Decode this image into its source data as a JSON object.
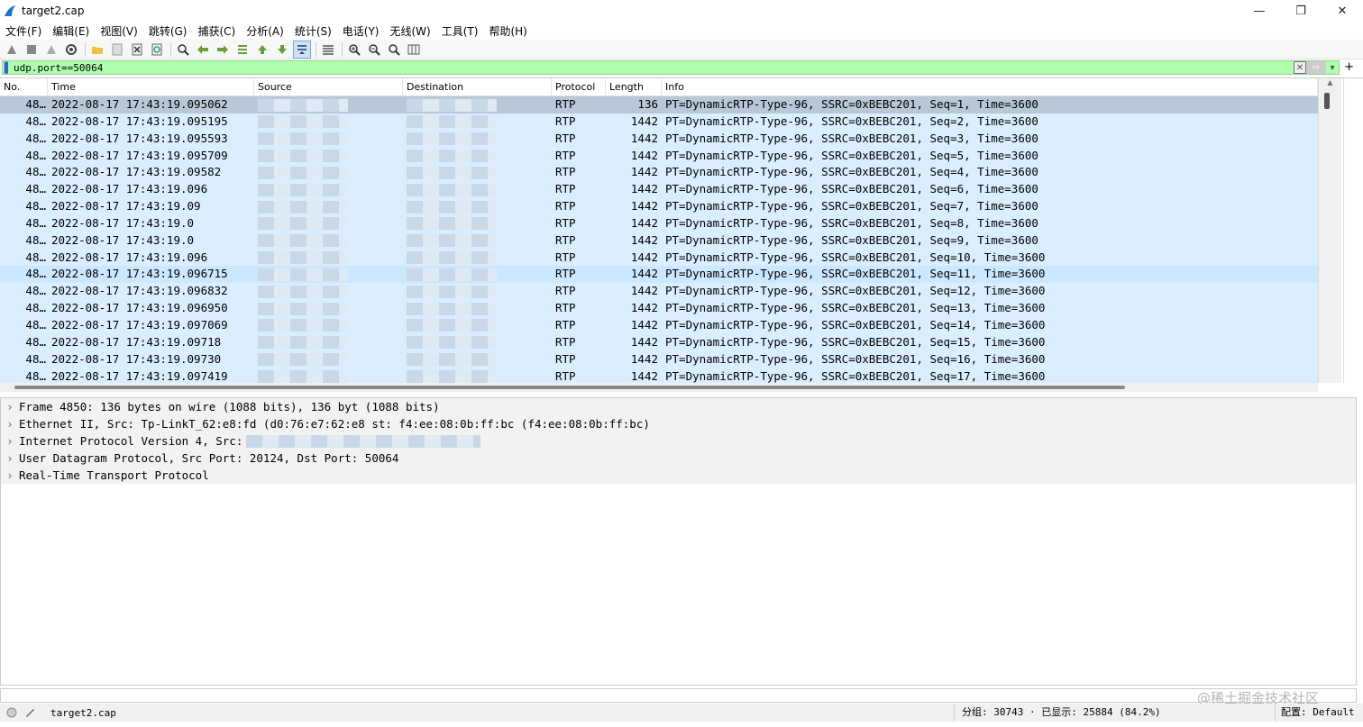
{
  "window": {
    "title": "target2.cap",
    "minimize": "—",
    "restore": "❐",
    "close": "✕"
  },
  "menu": [
    "文件(F)",
    "编辑(E)",
    "视图(V)",
    "跳转(G)",
    "捕获(C)",
    "分析(A)",
    "统计(S)",
    "电话(Y)",
    "无线(W)",
    "工具(T)",
    "帮助(H)"
  ],
  "filter": {
    "value": "udp.port==50064",
    "plus": "+"
  },
  "columns": {
    "no": "No.",
    "time": "Time",
    "source": "Source",
    "destination": "Destination",
    "protocol": "Protocol",
    "length": "Length",
    "info": "Info"
  },
  "packets": [
    {
      "no": "48…",
      "time": "2022-08-17 17:43:19.095062",
      "protocol": "RTP",
      "length": "136",
      "info": "PT=DynamicRTP-Type-96, SSRC=0xBEBC201, Seq=1, Time=3600"
    },
    {
      "no": "48…",
      "time": "2022-08-17 17:43:19.095195",
      "protocol": "RTP",
      "length": "1442",
      "info": "PT=DynamicRTP-Type-96, SSRC=0xBEBC201, Seq=2, Time=3600"
    },
    {
      "no": "48…",
      "time": "2022-08-17 17:43:19.095593",
      "protocol": "RTP",
      "length": "1442",
      "info": "PT=DynamicRTP-Type-96, SSRC=0xBEBC201, Seq=3, Time=3600"
    },
    {
      "no": "48…",
      "time": "2022-08-17 17:43:19.095709",
      "protocol": "RTP",
      "length": "1442",
      "info": "PT=DynamicRTP-Type-96, SSRC=0xBEBC201, Seq=5, Time=3600"
    },
    {
      "no": "48…",
      "time": "2022-08-17 17:43:19.09582",
      "protocol": "RTP",
      "length": "1442",
      "info": "PT=DynamicRTP-Type-96, SSRC=0xBEBC201, Seq=4, Time=3600"
    },
    {
      "no": "48…",
      "time": "2022-08-17 17:43:19.096",
      "protocol": "RTP",
      "length": "1442",
      "info": "PT=DynamicRTP-Type-96, SSRC=0xBEBC201, Seq=6, Time=3600"
    },
    {
      "no": "48…",
      "time": "2022-08-17 17:43:19.09",
      "protocol": "RTP",
      "length": "1442",
      "info": "PT=DynamicRTP-Type-96, SSRC=0xBEBC201, Seq=7, Time=3600"
    },
    {
      "no": "48…",
      "time": "2022-08-17 17:43:19.0",
      "protocol": "RTP",
      "length": "1442",
      "info": "PT=DynamicRTP-Type-96, SSRC=0xBEBC201, Seq=8, Time=3600"
    },
    {
      "no": "48…",
      "time": "2022-08-17 17:43:19.0",
      "protocol": "RTP",
      "length": "1442",
      "info": "PT=DynamicRTP-Type-96, SSRC=0xBEBC201, Seq=9, Time=3600"
    },
    {
      "no": "48…",
      "time": "2022-08-17 17:43:19.096",
      "protocol": "RTP",
      "length": "1442",
      "info": "PT=DynamicRTP-Type-96, SSRC=0xBEBC201, Seq=10, Time=3600"
    },
    {
      "no": "48…",
      "time": "2022-08-17 17:43:19.096715",
      "protocol": "RTP",
      "length": "1442",
      "info": "PT=DynamicRTP-Type-96, SSRC=0xBEBC201, Seq=11, Time=3600"
    },
    {
      "no": "48…",
      "time": "2022-08-17 17:43:19.096832",
      "protocol": "RTP",
      "length": "1442",
      "info": "PT=DynamicRTP-Type-96, SSRC=0xBEBC201, Seq=12, Time=3600"
    },
    {
      "no": "48…",
      "time": "2022-08-17 17:43:19.096950",
      "protocol": "RTP",
      "length": "1442",
      "info": "PT=DynamicRTP-Type-96, SSRC=0xBEBC201, Seq=13, Time=3600"
    },
    {
      "no": "48…",
      "time": "2022-08-17 17:43:19.097069",
      "protocol": "RTP",
      "length": "1442",
      "info": "PT=DynamicRTP-Type-96, SSRC=0xBEBC201, Seq=14, Time=3600"
    },
    {
      "no": "48…",
      "time": "2022-08-17 17:43:19.09718",
      "protocol": "RTP",
      "length": "1442",
      "info": "PT=DynamicRTP-Type-96, SSRC=0xBEBC201, Seq=15, Time=3600"
    },
    {
      "no": "48…",
      "time": "2022-08-17 17:43:19.09730",
      "protocol": "RTP",
      "length": "1442",
      "info": "PT=DynamicRTP-Type-96, SSRC=0xBEBC201, Seq=16, Time=3600"
    },
    {
      "no": "48…",
      "time": "2022-08-17 17:43:19.097419",
      "protocol": "RTP",
      "length": "1442",
      "info": "PT=DynamicRTP-Type-96, SSRC=0xBEBC201, Seq=17, Time=3600"
    }
  ],
  "details": [
    "Frame 4850: 136 bytes on wire (1088 bits), 136 byt          (1088 bits)",
    "Ethernet II, Src: Tp-LinkT_62:e8:fd (d0:76:e7:62:e8       st: f4:ee:08:0b:ff:bc (f4:ee:08:0b:ff:bc)",
    "Internet Protocol Version 4, Src:",
    "User Datagram Protocol, Src Port: 20124, Dst Port: 50064",
    "Real-Time Transport Protocol"
  ],
  "status": {
    "file": "target2.cap",
    "stats": "分组: 30743 · 已显示: 25884 (84.2%)",
    "profile": "配置: Default"
  },
  "watermark": "@稀土掘金技术社区",
  "colors": {
    "filter_ok": "#afffaf",
    "row_bg": "#daeeff",
    "row_selected": "#b8c8d8"
  }
}
